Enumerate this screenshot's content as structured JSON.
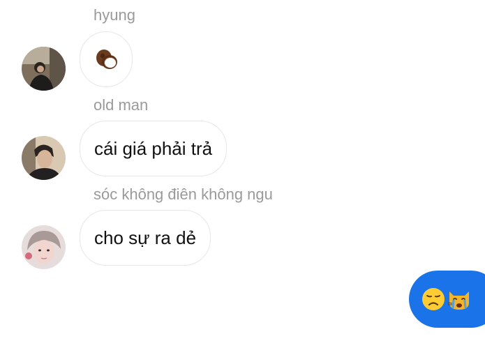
{
  "messages": [
    {
      "sender": "hyung",
      "text": "",
      "emoji": "coconut-emoji"
    },
    {
      "sender": "old man",
      "text": "cái giá phải trả"
    },
    {
      "sender": "sóc không điên không ngu",
      "text": "cho sự ra dẻ"
    }
  ],
  "my_message": {
    "emojis": [
      "disappointed-face-emoji",
      "crying-cat-emoji"
    ]
  },
  "colors": {
    "sender_name": "#9a9a9a",
    "bubble_border": "#e6e6e6",
    "my_bubble": "#1a73e8"
  }
}
